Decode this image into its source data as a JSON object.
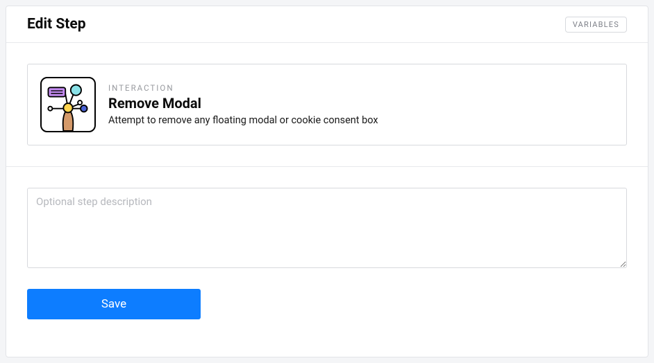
{
  "header": {
    "title": "Edit Step",
    "variables_label": "VARIABLES"
  },
  "step": {
    "category_label": "INTERACTION",
    "title": "Remove Modal",
    "description": "Attempt to remove any floating modal or cookie consent box",
    "icon_name": "remove-modal-icon"
  },
  "form": {
    "description_value": "",
    "description_placeholder": "Optional step description",
    "save_label": "Save"
  },
  "colors": {
    "accent": "#0d7dff",
    "border": "#d7d9dd",
    "muted_text": "#97999e"
  }
}
